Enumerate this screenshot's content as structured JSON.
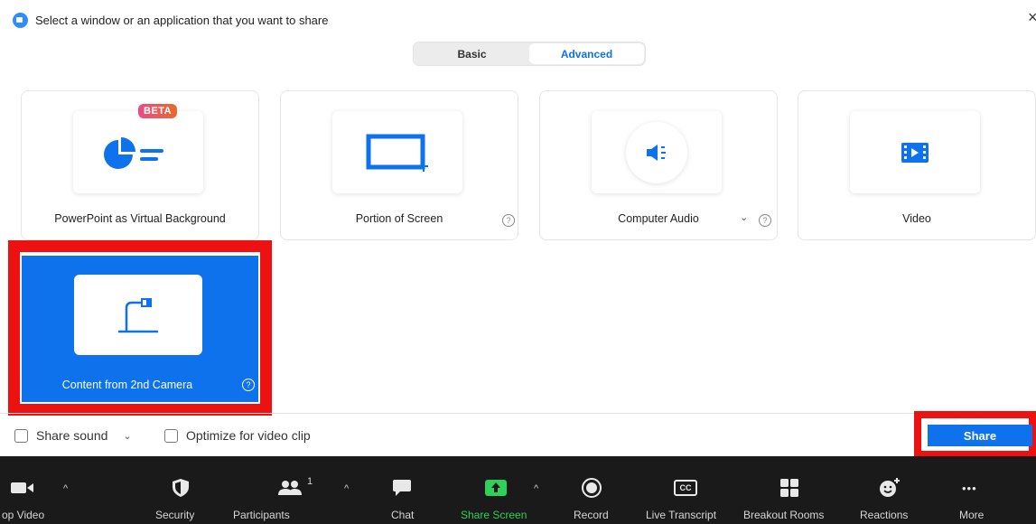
{
  "window": {
    "title": "Select a window or an application that you want to share",
    "close_icon": "×"
  },
  "tabs": [
    {
      "label": "Basic",
      "active": false
    },
    {
      "label": "Advanced",
      "active": true
    }
  ],
  "cards": [
    {
      "label": "PowerPoint as Virtual Background",
      "badge": "BETA",
      "icon": "powerpoint-pie-icon"
    },
    {
      "label": "Portion of Screen",
      "icon": "portion-screen-icon",
      "help": "?"
    },
    {
      "label": "Computer Audio",
      "icon": "speaker-icon",
      "help": "?",
      "chevron": "⌄"
    },
    {
      "label": "Video",
      "icon": "film-icon"
    },
    {
      "label": "Content from 2nd Camera",
      "icon": "document-camera-icon",
      "help": "?",
      "selected": true
    }
  ],
  "options": {
    "share_sound": "Share sound",
    "share_sound_chevron": "⌄",
    "optimize_video": "Optimize for video clip"
  },
  "share_button": "Share",
  "toolbar": [
    {
      "label": "op Video",
      "icon": "video-camera-icon",
      "caret": "^"
    },
    {
      "label": "Security",
      "icon": "shield-icon"
    },
    {
      "label": "Participants",
      "icon": "participants-icon",
      "count": "1",
      "caret": "^"
    },
    {
      "label": "Chat",
      "icon": "chat-icon"
    },
    {
      "label": "Share Screen",
      "icon": "share-screen-icon",
      "caret": "^"
    },
    {
      "label": "Record",
      "icon": "record-icon"
    },
    {
      "label": "Live Transcript",
      "icon": "cc-icon",
      "icon_text": "CC"
    },
    {
      "label": "Breakout Rooms",
      "icon": "breakout-rooms-icon"
    },
    {
      "label": "Reactions",
      "icon": "reactions-icon"
    },
    {
      "label": "More",
      "icon": "more-icon",
      "icon_text": "•••"
    }
  ],
  "colors": {
    "accent": "#0e72ed",
    "highlight": "#ee1111",
    "share_green": "#2fd05a",
    "toolbar_bg": "#1a1a1a"
  }
}
